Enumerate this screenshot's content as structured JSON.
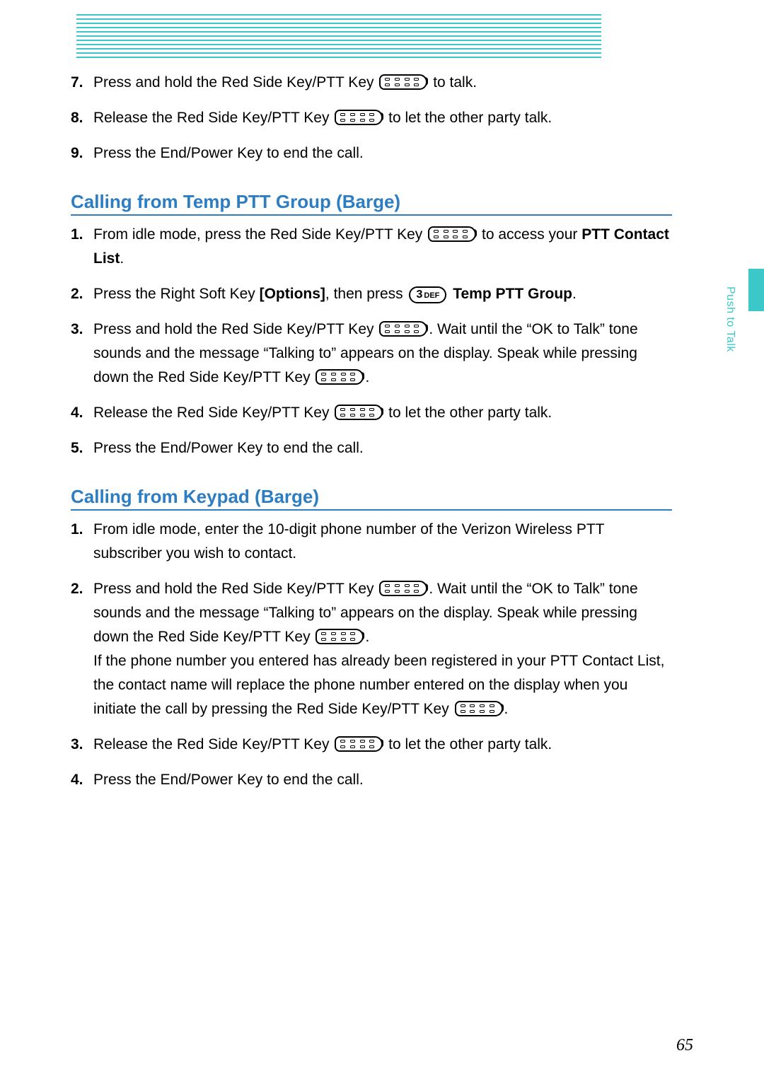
{
  "side_tab": "Push to Talk",
  "page_number": "65",
  "icons": {
    "ptt": "ptt-key-icon",
    "key3def_num": "3",
    "key3def_letters": "DEF"
  },
  "top_section": {
    "steps": [
      {
        "n": "7.",
        "pre": "Press and hold the Red Side Key/PTT Key ",
        "post": " to talk."
      },
      {
        "n": "8.",
        "pre": "Release the Red Side Key/PTT Key ",
        "post": " to let the other party talk."
      },
      {
        "n": "9.",
        "text": "Press the End/Power Key to end the call."
      }
    ]
  },
  "section_barge": {
    "heading": "Calling from Temp PTT Group (Barge)",
    "steps": {
      "s1": {
        "n": "1.",
        "pre": "From idle mode, press the Red Side Key/PTT Key ",
        "post1": " to access your ",
        "bold1": "PTT Contact List",
        "end": "."
      },
      "s2": {
        "n": "2.",
        "pre": "Press the Right Soft Key ",
        "bold1": "[Options]",
        "mid": ", then press ",
        "bold2": "Temp PTT Group",
        "end": "."
      },
      "s3": {
        "n": "3.",
        "pre": "Press and hold the Red Side Key/PTT Key ",
        "mid": ". Wait until the “OK to Talk” tone sounds and the message “Talking to” appears on the display. Speak while pressing down the Red Side Key/PTT Key ",
        "end": "."
      },
      "s4": {
        "n": "4.",
        "pre": "Release the Red Side Key/PTT Key ",
        "post": " to let the other party talk."
      },
      "s5": {
        "n": "5.",
        "text": "Press the End/Power Key to end the call."
      }
    }
  },
  "section_keypad": {
    "heading": "Calling from Keypad (Barge)",
    "steps": {
      "s1": {
        "n": "1.",
        "text": "From idle mode, enter the 10-digit phone number of the Verizon Wireless PTT subscriber you wish to contact."
      },
      "s2": {
        "n": "2.",
        "pre": "Press and hold the Red Side Key/PTT Key ",
        "mid": ". Wait until the “OK to Talk” tone sounds and the message “Talking to” appears on the display. Speak while pressing down the Red Side Key/PTT Key ",
        "end": ".",
        "para2_pre": "If the phone number you entered has already been registered in your PTT Contact List, the contact name will replace the phone number entered on the display when you initiate the call by pressing the Red Side Key/PTT Key ",
        "para2_end": "."
      },
      "s3": {
        "n": "3.",
        "pre": "Release the Red Side Key/PTT Key ",
        "post": " to let the other party talk."
      },
      "s4": {
        "n": "4.",
        "text": "Press the End/Power Key to end the call."
      }
    }
  }
}
